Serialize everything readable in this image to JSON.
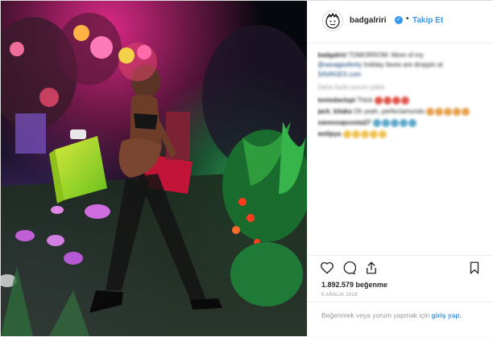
{
  "post": {
    "username": "badgalriri",
    "follow_dot": "•",
    "follow_label": "Takip Et",
    "verified_mark": "✓",
    "caption": {
      "username": "badgalriri",
      "text_line1": "TOMORROW. More of my",
      "tag": "@savagexfenty",
      "text_line2": "holiday faves are droppin at",
      "text_line3": "SAVAGEX.com"
    },
    "see_translation": "Daha fazla yorum yükle",
    "comments": [
      {
        "user": "tonisdaclupi",
        "text": "Thick",
        "emojis": [
          "#e0534a",
          "#e0534a",
          "#e0534a",
          "#e0534a"
        ]
      },
      {
        "user": "jack_kitaka",
        "text": "Oh yeah, perfectamundo",
        "emojis": [
          "#e8a04b",
          "#e8a04b",
          "#e8a04b",
          "#e8a04b",
          "#e8a04b"
        ]
      },
      {
        "user": "vanessapcosta27",
        "text": "",
        "emojis": [
          "#5aa6c9",
          "#5aa6c9",
          "#5aa6c9",
          "#5aa6c9",
          "#5aa6c9"
        ]
      },
      {
        "user": "wolipya",
        "text": "",
        "emojis": [
          "#f2c14e",
          "#f2c14e",
          "#f2c14e",
          "#f2c14e",
          "#f2c14e"
        ]
      }
    ],
    "likes": "1.892.579 beğenme",
    "date": "5 ARALIK 2018",
    "footer": {
      "text": "Beğenmek veya yorum yapmak için",
      "link": "giriş",
      "link_rest": "yap."
    },
    "icons": [
      "heart-icon",
      "comment-icon",
      "share-icon",
      "bookmark-icon"
    ],
    "accent_color": "#3897f0"
  }
}
